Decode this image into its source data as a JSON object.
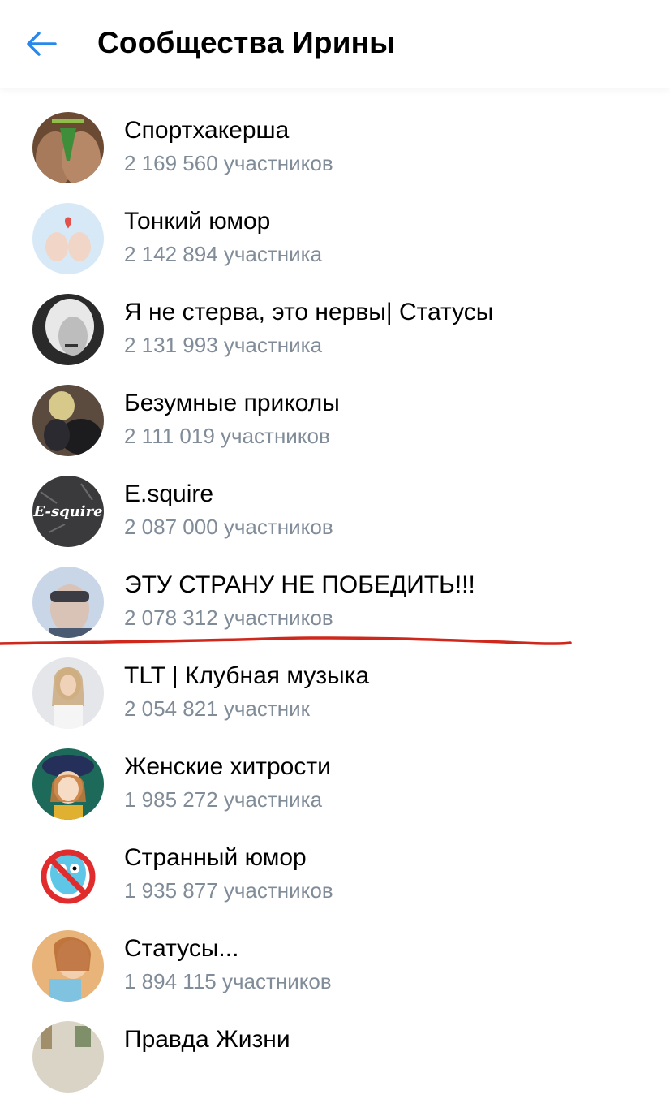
{
  "header": {
    "title": "Сообщества Ирины",
    "back_icon": "arrow-left-icon"
  },
  "colors": {
    "accent": "#2688eb",
    "secondary_text": "#818c99",
    "annotation_line": "#d0271c"
  },
  "communities": [
    {
      "name": "Спортхакерша",
      "members": "2 169 560 участников"
    },
    {
      "name": "Тонкий юмор",
      "members": "2 142 894 участника"
    },
    {
      "name": "Я не стерва, это нервы| Статусы",
      "members": "2 131 993 участника"
    },
    {
      "name": "Безумные приколы",
      "members": "2 111 019 участников"
    },
    {
      "name": "E.squire",
      "members": "2 087 000 участников",
      "avatar_text": "E-squire"
    },
    {
      "name": "ЭТУ СТРАНУ НЕ ПОБЕДИТЬ!!!",
      "members": "2 078 312 участников"
    },
    {
      "name": "TLT | Клубная музыка",
      "members": "2 054 821 участник"
    },
    {
      "name": "Женские хитрости",
      "members": "1 985 272 участника"
    },
    {
      "name": "Странный юмор",
      "members": "1 935 877 участников"
    },
    {
      "name": "Статусы...",
      "members": "1 894 115 участников"
    },
    {
      "name": "Правда Жизни",
      "members": ""
    }
  ]
}
